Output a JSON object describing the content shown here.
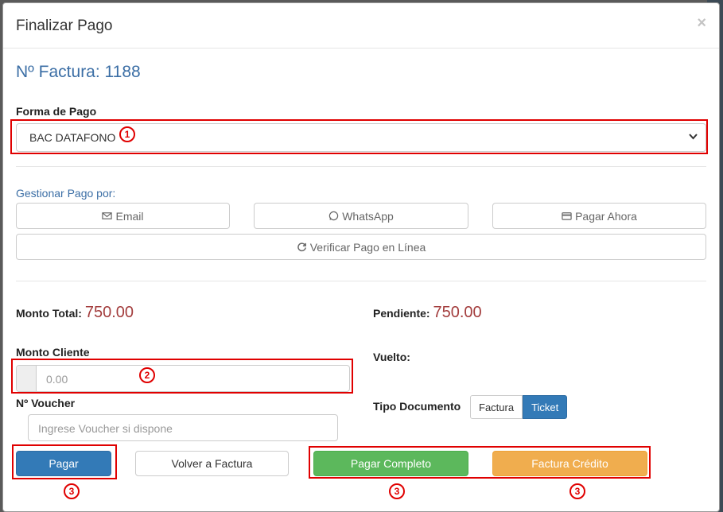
{
  "modal": {
    "title": "Finalizar Pago",
    "close_glyph": "×"
  },
  "invoice": {
    "label": "Nº Factura: 1188"
  },
  "payment_method": {
    "label": "Forma de Pago",
    "selected": "BAC DATAFONO"
  },
  "manage": {
    "label": "Gestionar Pago por:",
    "email": "Email",
    "whatsapp": "WhatsApp",
    "pay_now": "Pagar Ahora",
    "verify": "Verificar Pago en Línea"
  },
  "totals": {
    "total_label": "Monto Total:",
    "total_value": "750.00",
    "pending_label": "Pendiente:",
    "pending_value": "750.00",
    "client_label": "Monto Cliente",
    "client_placeholder": "0.00",
    "change_label": "Vuelto:"
  },
  "voucher": {
    "label": "Nº Voucher",
    "placeholder": "Ingrese Voucher si dispone"
  },
  "document_type": {
    "label": "Tipo Documento",
    "options": [
      "Factura",
      "Ticket"
    ],
    "selected": "Ticket"
  },
  "actions": {
    "pay": "Pagar",
    "back": "Volver a Factura",
    "pay_full": "Pagar Completo",
    "credit_invoice": "Factura Crédito"
  },
  "annotations": {
    "marker_1": "1",
    "marker_2": "2",
    "marker_3": "3",
    "color": "#e00000"
  },
  "colors": {
    "primary": "#337ab7",
    "success": "#5cb85c",
    "warning": "#f0ad4e",
    "money": "#a33d3d",
    "link": "#3b6ea5"
  }
}
